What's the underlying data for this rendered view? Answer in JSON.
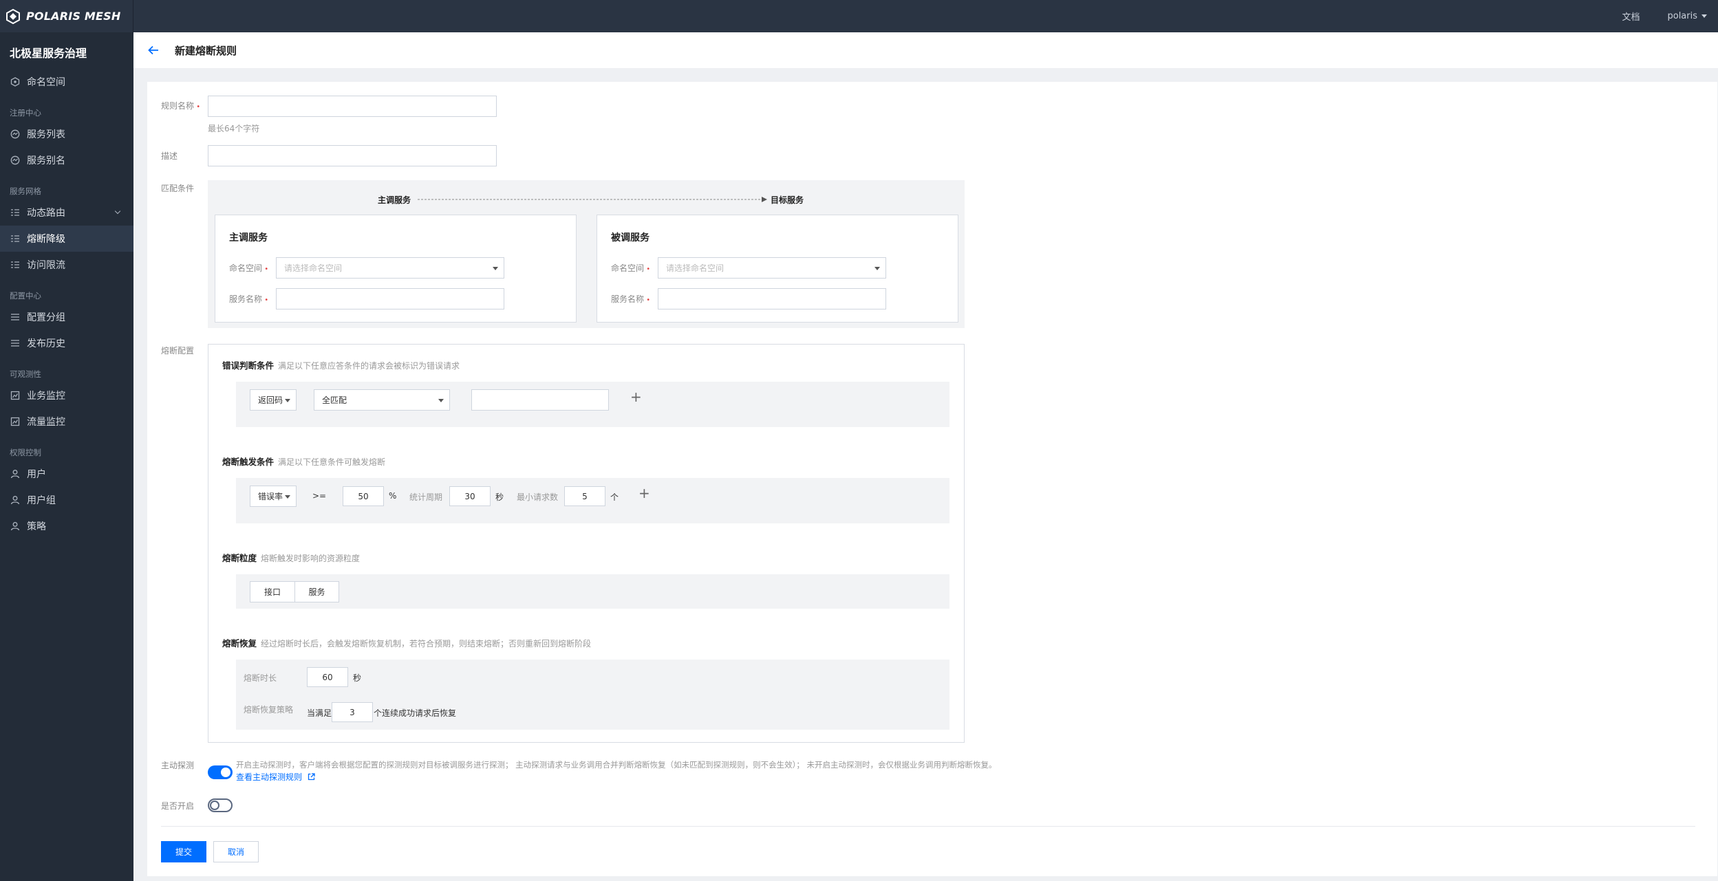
{
  "topbar": {
    "logo": "POLARIS MESH",
    "docs": "文档",
    "user": "polaris"
  },
  "sidebar": {
    "title": "北极星服务治理",
    "namespace": "命名空间",
    "groups": {
      "registry": "注册中心",
      "mesh": "服务网格",
      "config": "配置中心",
      "observability": "可观测性",
      "auth": "权限控制"
    },
    "items": {
      "service_list": "服务列表",
      "service_alias": "服务别名",
      "dynamic_route": "动态路由",
      "circuit_breaker": "熔断降级",
      "rate_limit": "访问限流",
      "config_group": "配置分组",
      "release_history": "发布历史",
      "business_monitor": "业务监控",
      "traffic_monitor": "流量监控",
      "user": "用户",
      "user_group": "用户组",
      "policy": "策略"
    }
  },
  "header": {
    "title": "新建熔断规则"
  },
  "form": {
    "rule_name_label": "规则名称",
    "rule_name_value": "",
    "rule_name_hint": "最长64个字符",
    "desc_label": "描述",
    "desc_value": "",
    "match_label": "匹配条件",
    "flow_source": "主调服务",
    "flow_target": "目标服务",
    "caller": {
      "title": "主调服务",
      "ns_label": "命名空间",
      "ns_placeholder": "请选择命名空间",
      "svc_label": "服务名称",
      "svc_value": ""
    },
    "callee": {
      "title": "被调服务",
      "ns_label": "命名空间",
      "ns_placeholder": "请选择命名空间",
      "svc_label": "服务名称",
      "svc_value": ""
    },
    "cb_config_label": "熔断配置",
    "error": {
      "title": "错误判断条件",
      "desc": "满足以下任意应答条件的请求会被标识为错误请求",
      "type": "返回码",
      "match": "全匹配",
      "value": ""
    },
    "trigger": {
      "title": "熔断触发条件",
      "desc": "满足以下任意条件可触发熔断",
      "type": "错误率",
      "op": ">=",
      "threshold": "50",
      "threshold_unit": "%",
      "period_label": "统计周期",
      "period": "30",
      "period_unit": "秒",
      "min_req_label": "最小请求数",
      "min_req": "5",
      "min_req_unit": "个"
    },
    "granularity": {
      "title": "熔断粒度",
      "desc": "熔断触发时影响的资源粒度",
      "opt_interface": "接口",
      "opt_service": "服务"
    },
    "recover": {
      "title": "熔断恢复",
      "desc": "经过熔断时长后，会触发熔断恢复机制，若符合预期，则结束熔断；否则重新回到熔断阶段",
      "duration_label": "熔断时长",
      "duration": "60",
      "duration_unit": "秒",
      "strategy_label": "熔断恢复策略",
      "strategy_prefix": "当满足",
      "strategy_count": "3",
      "strategy_suffix": "个连续成功请求后恢复"
    },
    "probe_label": "主动探测",
    "probe_desc": "开启主动探测时，客户端将会根据您配置的探测规则对目标被调服务进行探测； 主动探测请求与业务调用合并判断熔断恢复（如未匹配到探测规则，则不会生效）； 未开启主动探测时，会仅根据业务调用判断熔断恢复。",
    "probe_link": "查看主动探测规则",
    "enable_label": "是否开启",
    "submit": "提交",
    "cancel": "取消"
  },
  "colors": {
    "primary": "#006eff",
    "sidebar_bg": "#232c38",
    "topbar_bg": "#2a3443"
  }
}
